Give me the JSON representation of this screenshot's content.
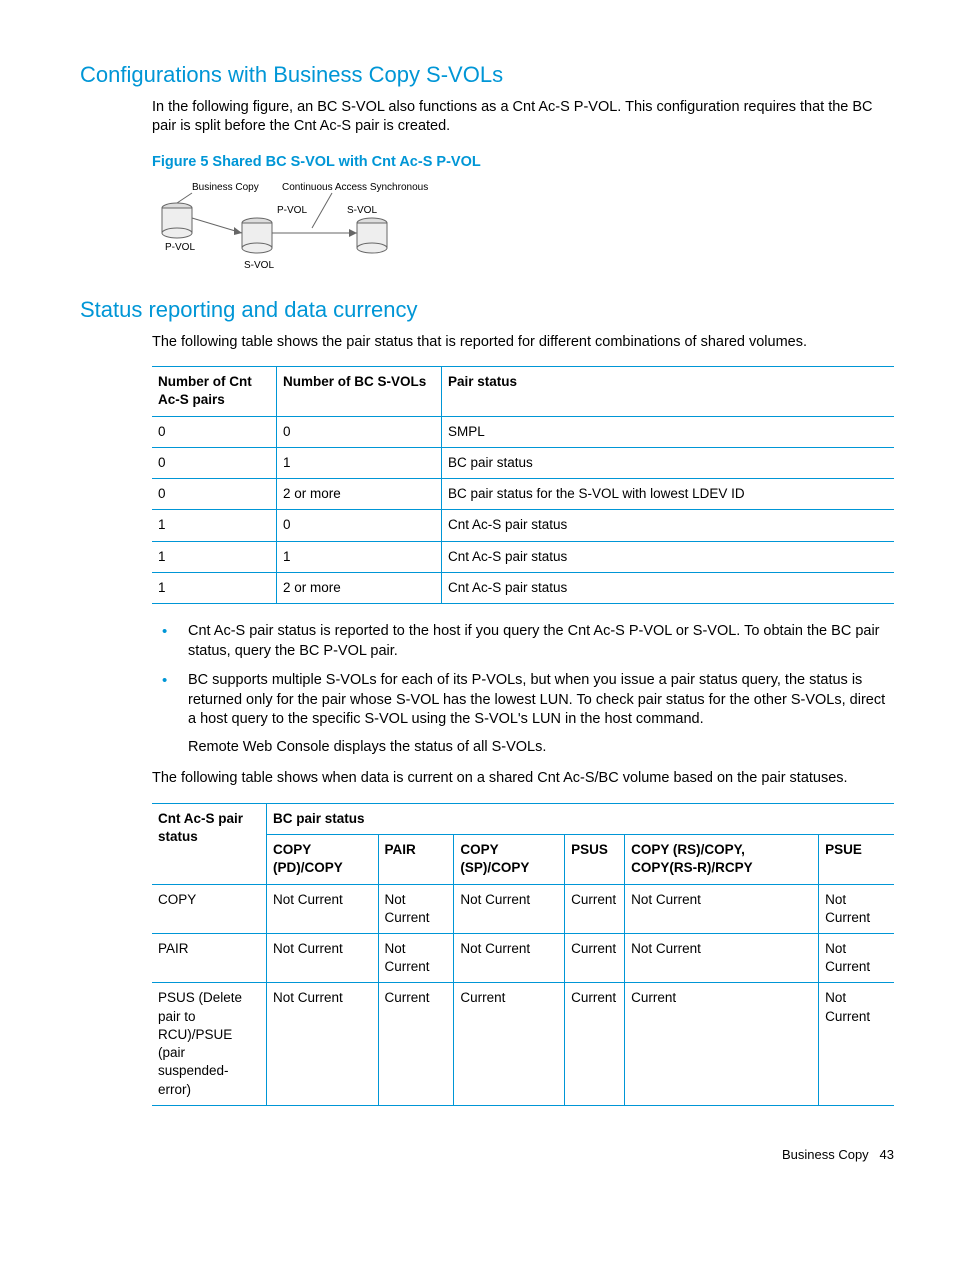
{
  "heading1": "Configurations with Business Copy S-VOLs",
  "para1": "In the following figure, an BC S-VOL also functions as a Cnt Ac-S P-VOL. This configuration requires that the BC pair is split before the Cnt Ac-S pair is created.",
  "figure_title": "Figure 5 Shared BC S-VOL with Cnt Ac-S P-VOL",
  "diagram": {
    "bc_label": "Business Copy",
    "cas_label": "Continuous Access Synchronous",
    "pvol1": "P-VOL",
    "svol1": "S-VOL",
    "pvol2": "P-VOL",
    "svol2": "S-VOL"
  },
  "heading2": "Status reporting and data currency",
  "para2": "The following table shows the pair status that is reported for different combinations of shared volumes.",
  "table1": {
    "h1": "Number of Cnt Ac-S pairs",
    "h2": "Number of BC S-VOLs",
    "h3": "Pair status",
    "rows": [
      {
        "c1": "0",
        "c2": "0",
        "c3": "SMPL"
      },
      {
        "c1": "0",
        "c2": "1",
        "c3": "BC pair status"
      },
      {
        "c1": "0",
        "c2": "2 or more",
        "c3": "BC pair status for the S-VOL with lowest LDEV ID"
      },
      {
        "c1": "1",
        "c2": "0",
        "c3": "Cnt Ac-S pair status"
      },
      {
        "c1": "1",
        "c2": "1",
        "c3": "Cnt Ac-S pair status"
      },
      {
        "c1": "1",
        "c2": "2 or more",
        "c3": "Cnt Ac-S pair status"
      }
    ]
  },
  "bullets": [
    "Cnt Ac-S pair status is reported to the host if you query the Cnt Ac-S P-VOL or S-VOL. To obtain the BC pair status, query the BC P-VOL pair.",
    "BC supports multiple S-VOLs for each of its P-VOLs, but when you issue a pair status query, the status is returned only for the pair whose S-VOL has the lowest LUN. To check pair status for the other S-VOLs, direct a host query to the specific S-VOL using the S-VOL's LUN in the host command."
  ],
  "bullet2_sub": "Remote Web Console displays the status of all S-VOLs.",
  "para3": "The following table shows when data is current on a shared Cnt Ac-S/BC volume based on the pair statuses.",
  "table2": {
    "rh": "Cnt Ac-S pair status",
    "gh": "BC pair status",
    "cols": [
      "COPY (PD)/COPY",
      "PAIR",
      "COPY (SP)/COPY",
      "PSUS",
      "COPY (RS)/COPY, COPY(RS-R)/RCPY",
      "PSUE"
    ],
    "rows": [
      {
        "label": "COPY",
        "cells": [
          "Not Current",
          "Not Current",
          "Not Current",
          "Current",
          "Not Current",
          "Not Current"
        ]
      },
      {
        "label": "PAIR",
        "cells": [
          "Not Current",
          "Not Current",
          "Not Current",
          "Current",
          "Not Current",
          "Not Current"
        ]
      },
      {
        "label": "PSUS (Delete pair to RCU)/PSUE (pair suspended-error)",
        "cells": [
          "Not Current",
          "Current",
          "Current",
          "Current",
          "Current",
          "Not Current"
        ]
      }
    ]
  },
  "footer_text": "Business Copy",
  "footer_page": "43"
}
